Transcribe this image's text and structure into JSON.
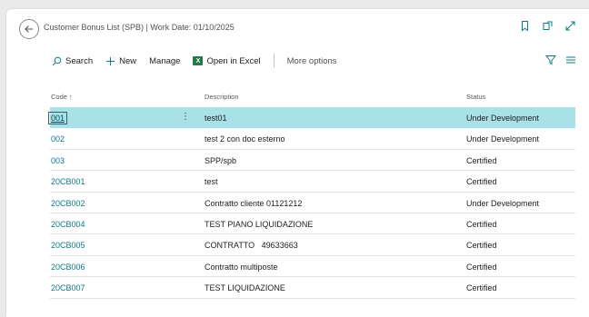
{
  "page": {
    "title": "Customer Bonus List (SPB) | Work Date: 01/10/2025"
  },
  "toolbar": {
    "search_label": "Search",
    "new_label": "New",
    "manage_label": "Manage",
    "excel_label": "Open in Excel",
    "more_label": "More options"
  },
  "table": {
    "headers": {
      "code": "Code ↑",
      "description": "Description",
      "status": "Status"
    },
    "rows": [
      {
        "code": "001",
        "description": "test01",
        "status": "Under Development"
      },
      {
        "code": "002",
        "description": "test 2 con doc esterno",
        "status": "Under Development"
      },
      {
        "code": "003",
        "description": "SPP/spb",
        "status": "Certified"
      },
      {
        "code": "20CB001",
        "description": "test",
        "status": "Certified"
      },
      {
        "code": "20CB002",
        "description": "Contratto cliente 01121212",
        "status": "Under Development"
      },
      {
        "code": "20CB004",
        "description": "TEST PIANO LIQUIDAZIONE",
        "status": "Certified"
      },
      {
        "code": "20CB005",
        "description": "CONTRATTO   49633663",
        "status": "Certified"
      },
      {
        "code": "20CB006",
        "description": "Contratto multiposte",
        "status": "Certified"
      },
      {
        "code": "20CB007",
        "description": "TEST LIQUIDAZIONE",
        "status": "Certified"
      }
    ]
  },
  "colors": {
    "accent": "#0e7a88",
    "selected_row": "#a8e1e8"
  }
}
